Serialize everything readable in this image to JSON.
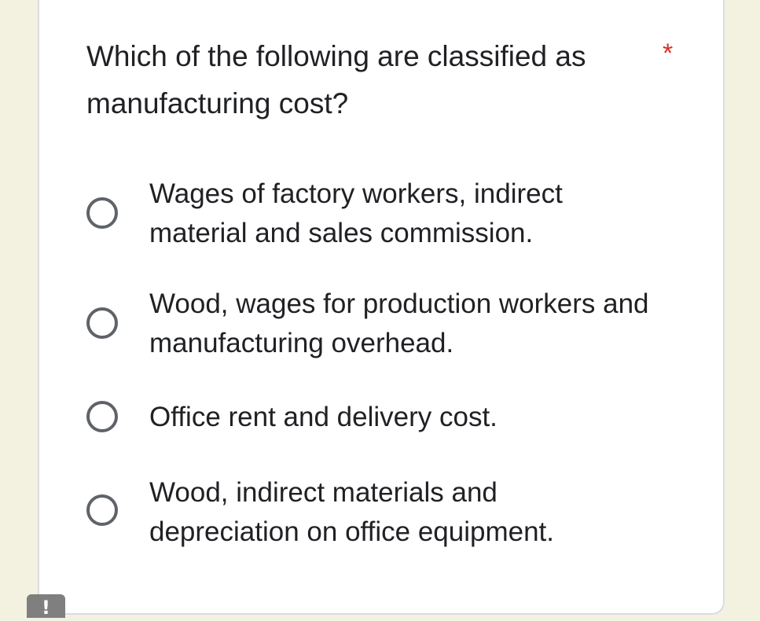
{
  "question": {
    "text": "Which of the following are classified as manufacturing cost?",
    "required_marker": "*"
  },
  "options": [
    {
      "label": "Wages of factory workers, indirect material and sales commission.",
      "selected": false
    },
    {
      "label": "Wood, wages for production workers and manufacturing overhead.",
      "selected": false
    },
    {
      "label": "Office rent and delivery cost.",
      "selected": false
    },
    {
      "label": "Wood, indirect materials and depreciation on office equipment.",
      "selected": false
    }
  ],
  "badge": {
    "icon": "exclamation-icon",
    "symbol": "!"
  },
  "colors": {
    "background": "#f3f2e1",
    "card": "#ffffff",
    "required": "#d93025",
    "radio_border": "#5f6368",
    "text": "#202124"
  }
}
